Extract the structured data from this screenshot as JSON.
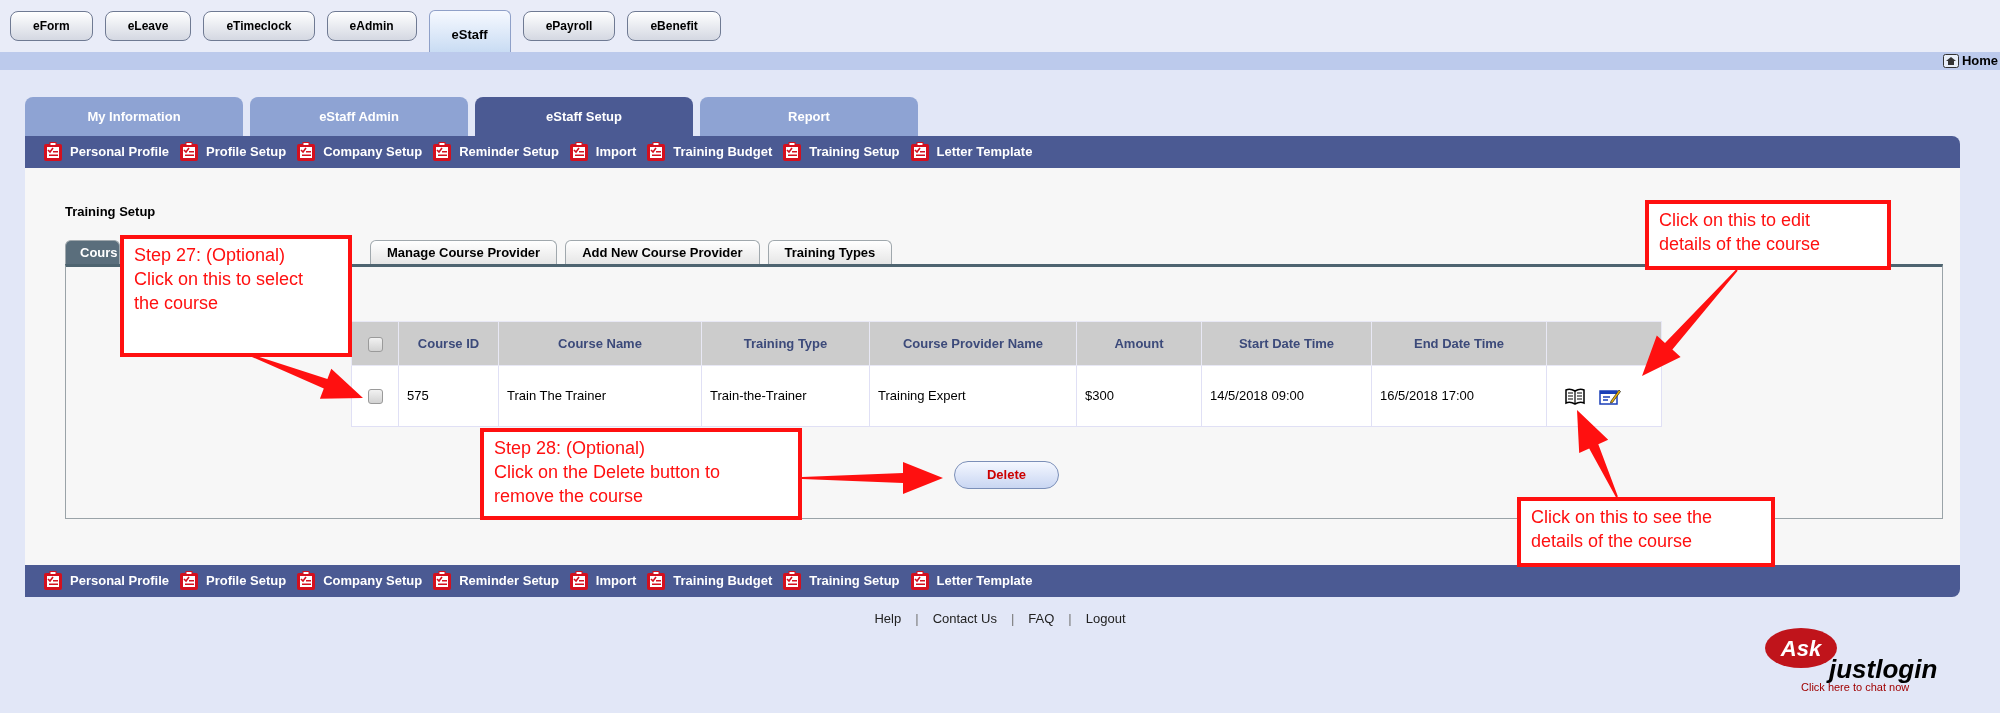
{
  "app_tabs": [
    {
      "label": "eForm",
      "selected": false
    },
    {
      "label": "eLeave",
      "selected": false
    },
    {
      "label": "eTimeclock",
      "selected": false
    },
    {
      "label": "eAdmin",
      "selected": false
    },
    {
      "label": "eStaff",
      "selected": true
    },
    {
      "label": "ePayroll",
      "selected": false
    },
    {
      "label": "eBenefit",
      "selected": false
    }
  ],
  "home_link": "Home",
  "main_tabs": [
    {
      "label": "My Information",
      "selected": false
    },
    {
      "label": "eStaff Admin",
      "selected": false
    },
    {
      "label": "eStaff Setup",
      "selected": true
    },
    {
      "label": "Report",
      "selected": false
    }
  ],
  "toolbar": [
    "Personal Profile",
    "Profile Setup",
    "Company Setup",
    "Reminder Setup",
    "Import",
    "Training Budget",
    "Training Setup",
    "Letter Template"
  ],
  "section_title": "Training Setup",
  "sub_tabs": [
    {
      "label": "Cours",
      "selected": true
    },
    {
      "label": "Manage Course Provider",
      "selected": false
    },
    {
      "label": "Add New Course Provider",
      "selected": false
    },
    {
      "label": "Training Types",
      "selected": false
    }
  ],
  "table": {
    "select_all_checked": false,
    "columns": [
      "Course ID",
      "Course Name",
      "Training Type",
      "Course Provider Name",
      "Amount",
      "Start Date Time",
      "End Date Time"
    ],
    "rows": [
      {
        "checked": false,
        "cells": [
          "575",
          "Train The Trainer",
          "Train-the-Trainer",
          "Training Expert",
          "$300",
          "14/5/2018 09:00",
          "16/5/2018 17:00"
        ]
      }
    ]
  },
  "delete_button": "Delete",
  "bottom_toolbar": [
    "Personal Profile",
    "Profile Setup",
    "Company Setup",
    "Reminder Setup",
    "Import",
    "Training Budget",
    "Training Setup",
    "Letter Template"
  ],
  "footer_links": [
    {
      "kind": "link",
      "label": "Help"
    },
    {
      "kind": "separator",
      "label": "|"
    },
    {
      "kind": "link",
      "label": "Contact Us"
    },
    {
      "kind": "separator",
      "label": "|"
    },
    {
      "kind": "link",
      "label": "FAQ"
    },
    {
      "kind": "separator",
      "label": "|"
    },
    {
      "kind": "link",
      "label": "Logout"
    }
  ],
  "chat_logo": {
    "badge": "Ask",
    "brand": "justlogin",
    "tagline": "Click here to chat now"
  },
  "callouts": [
    {
      "lines": [
        "Step 27: (Optional)",
        "Click on this to select",
        "the course"
      ]
    },
    {
      "lines": [
        "Step 28: (Optional)",
        "Click on the Delete button to",
        "remove the course"
      ]
    },
    {
      "lines": [
        "Click on this to edit",
        "details of the course"
      ]
    },
    {
      "lines": [
        "Click on this to see the",
        "details of the course"
      ]
    }
  ]
}
